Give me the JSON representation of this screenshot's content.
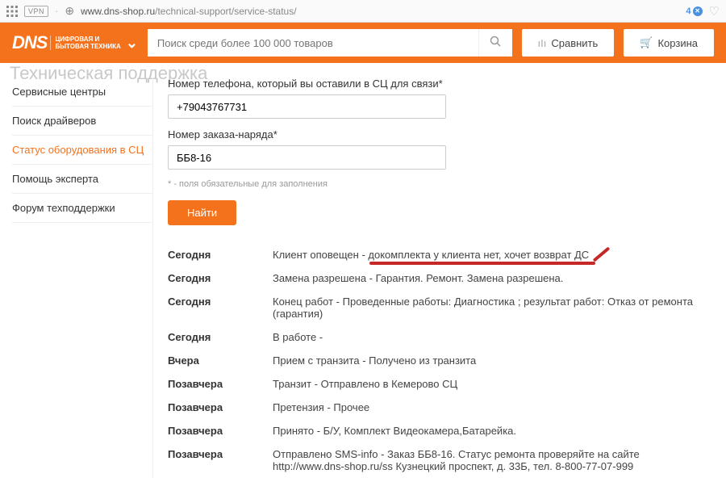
{
  "browser": {
    "vpn": "VPN",
    "url_domain": "www.dns-shop.ru",
    "url_path": "/technical-support/service-status/",
    "tab_count": "4"
  },
  "header": {
    "logo_main": "DNS",
    "logo_sub1": "ЦИФРОВАЯ И",
    "logo_sub2": "БЫТОВАЯ ТЕХНИКА",
    "search_placeholder": "Поиск среди более 100 000 товаров",
    "compare_label": "Сравнить",
    "cart_label": "Корзина",
    "page_title_faded": "Техническая поддержка"
  },
  "sidebar": {
    "items": [
      {
        "label": "Сервисные центры"
      },
      {
        "label": "Поиск драйверов"
      },
      {
        "label": "Статус оборудования в СЦ"
      },
      {
        "label": "Помощь эксперта"
      },
      {
        "label": "Форум техподдержки"
      }
    ]
  },
  "form": {
    "phone_label": "Номер телефона, который вы оставили в СЦ для связи*",
    "phone_value": "+79043767731",
    "order_label": "Номер заказа-наряда*",
    "order_value": "ББ8-16",
    "required_note": "* - поля обязательные для заполнения",
    "find_label": "Найти"
  },
  "status": [
    {
      "date": "Сегодня",
      "text": "Клиент оповещен - докомплекта у клиента нет, хочет возврат ДС",
      "highlight": true
    },
    {
      "date": "Сегодня",
      "text": "Замена разрешена - Гарантия. Ремонт. Замена разрешена."
    },
    {
      "date": "Сегодня",
      "text": "Конец работ - Проведенные работы: Диагностика ; результат работ: Отказ от ремонта (гарантия)"
    },
    {
      "date": "Сегодня",
      "text": "В работе -"
    },
    {
      "date": "Вчера",
      "text": "Прием с транзита - Получено из транзита"
    },
    {
      "date": "Позавчера",
      "text": "Транзит - Отправлено в Кемерово СЦ"
    },
    {
      "date": "Позавчера",
      "text": "Претензия - Прочее"
    },
    {
      "date": "Позавчера",
      "text": "Принято - Б/У, Комплект Видеокамера,Батарейка."
    },
    {
      "date": "Позавчера",
      "text": "Отправлено SMS-info - Заказ ББ8-16. Статус ремонта проверяйте на сайте http://www.dns-shop.ru/ss Кузнецкий проспект, д. 33Б, тел. 8-800-77-07-999"
    }
  ]
}
